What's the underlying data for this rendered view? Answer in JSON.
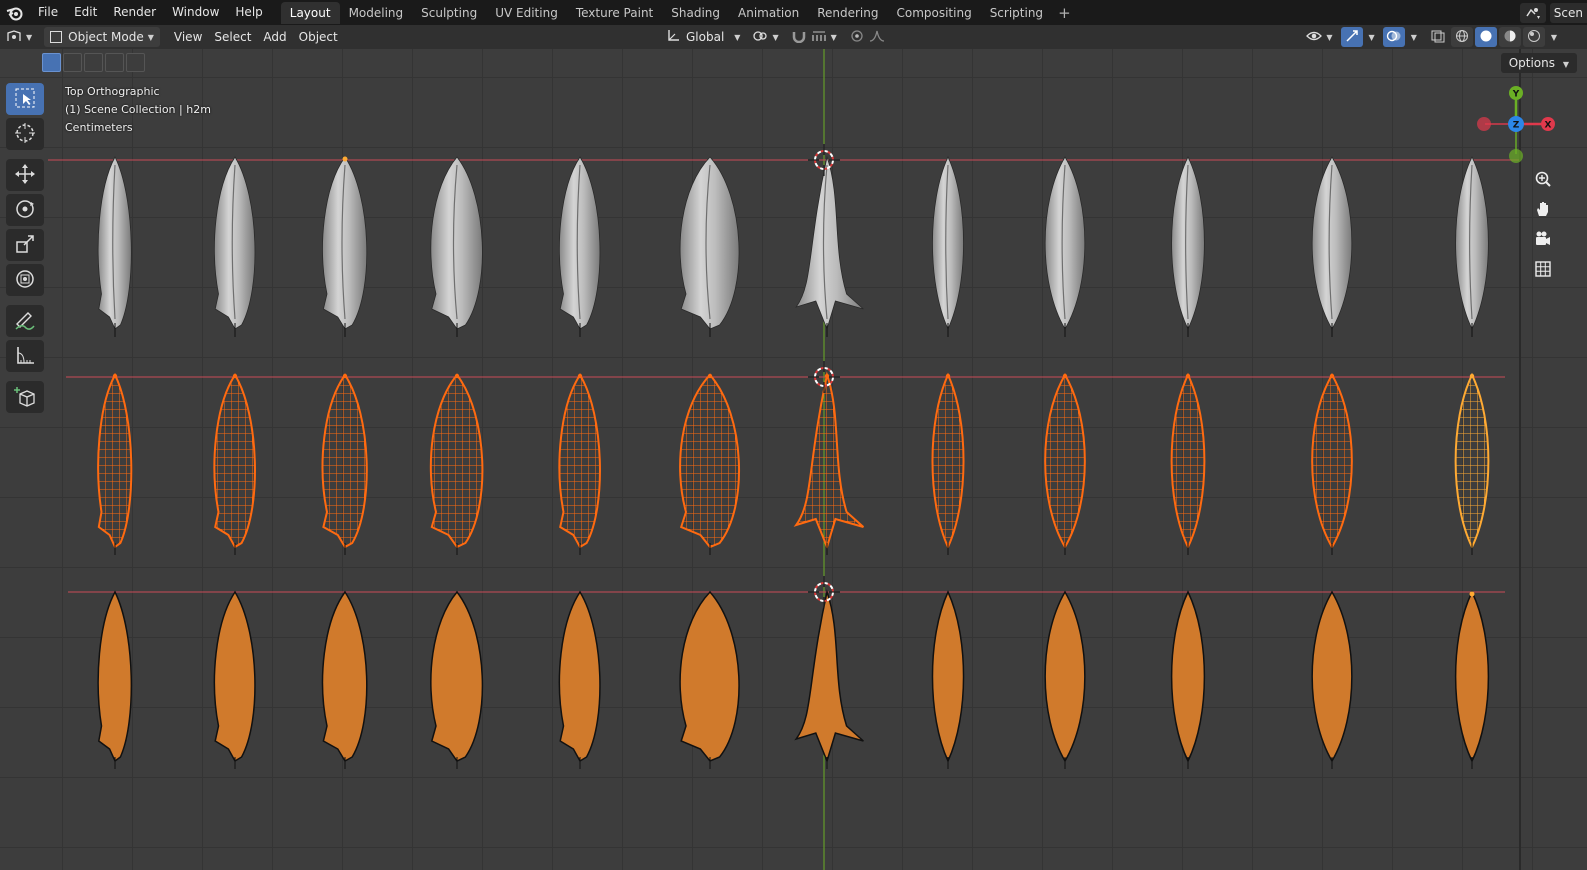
{
  "topbar": {
    "menus": [
      "File",
      "Edit",
      "Render",
      "Window",
      "Help"
    ],
    "workspaces": [
      "Layout",
      "Modeling",
      "Sculpting",
      "UV Editing",
      "Texture Paint",
      "Shading",
      "Animation",
      "Rendering",
      "Compositing",
      "Scripting"
    ],
    "active_workspace": "Layout",
    "add_tab": "+",
    "scene_name": "Scen"
  },
  "header": {
    "mode": "Object Mode",
    "menus": [
      "View",
      "Select",
      "Add",
      "Object"
    ],
    "transform_orientation": "Global"
  },
  "viewport": {
    "options_label": "Options",
    "view_name": "Top Orthographic",
    "collection_info": "(1) Scene Collection | h2m",
    "units": "Centimeters"
  },
  "gizmo": {
    "y": "Y",
    "z": "Z",
    "x": "X"
  },
  "toolbar": {
    "tools": [
      "select-box-icon",
      "cursor-icon",
      "move-icon",
      "rotate-icon",
      "scale-icon",
      "transform-icon",
      "annotate-icon",
      "measure-icon",
      "add-cube-icon"
    ]
  },
  "colors": {
    "accent": "#4772b3",
    "selected_orange": "#ff6a10",
    "active_yellow": "#ffaa33",
    "leaf_fill": "#d07a2c",
    "x_axis": "#e0394c",
    "y_axis": "#6bb025",
    "z_axis": "#2c87e8"
  }
}
